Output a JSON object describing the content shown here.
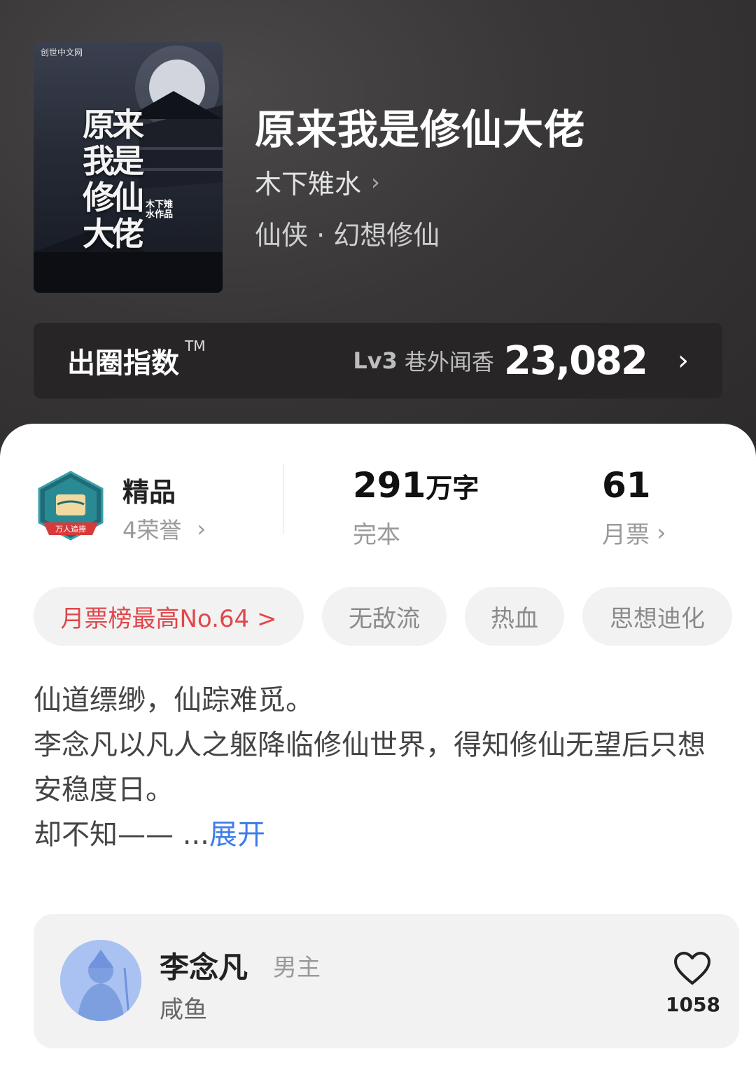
{
  "book": {
    "title": "原来我是修仙大佬",
    "author": "木下雉水",
    "genre": "仙侠 · 幻想修仙",
    "cover": {
      "title_text": "原来我是修仙大佬",
      "author_text": "木下雉水作品",
      "publisher_logo": "创世中文网"
    }
  },
  "index": {
    "label": "出圈指数",
    "trademark": "TM",
    "level": "Lv3",
    "level_name": "巷外闻香",
    "score": "23,082"
  },
  "stats": {
    "quality": "精品",
    "honors": "4荣誉",
    "badge_text": "万人追捧",
    "word_count": "291",
    "word_unit": "万字",
    "status": "完本",
    "monthly_tickets": "61",
    "monthly_ticket_label": "月票"
  },
  "tags": [
    "月票榜最高No.64 >",
    "无敌流",
    "热血",
    "思想迪化"
  ],
  "description": {
    "lines": [
      "仙道缥缈，仙踪难觅。",
      "李念凡以凡人之躯降临修仙世界，得知修仙无望后只想安稳度日。",
      "却不知—— ..."
    ],
    "expand": "展开"
  },
  "character": {
    "name": "李念凡",
    "role": "男主",
    "trait": "咸鱼",
    "likes": "1058"
  },
  "colors": {
    "accent_red": "#e0474c",
    "link_blue": "#3d7de8",
    "hero_bg": "#383636"
  }
}
